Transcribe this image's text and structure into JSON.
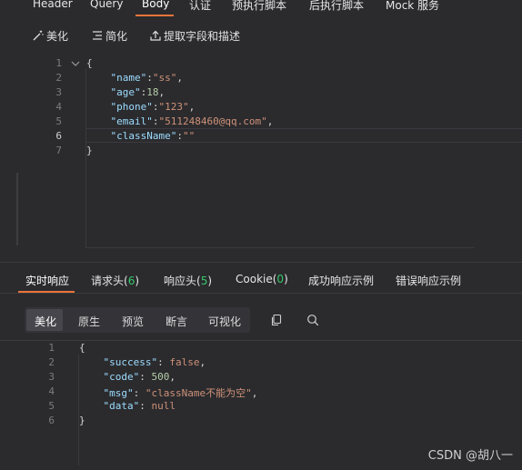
{
  "request_tabs": [
    "Header",
    "Query",
    "Body",
    "认证",
    "预执行脚本",
    "后执行脚本",
    "Mock 服务"
  ],
  "active_request_tab": "Body",
  "toolbar": {
    "beautify": "美化",
    "simplify": "简化",
    "extract": "提取字段和描述"
  },
  "request_body": {
    "line_numbers": [
      "1",
      "2",
      "3",
      "4",
      "5",
      "6",
      "7"
    ],
    "lines": [
      "{",
      "    \"name\":\"ss\",",
      "    \"age\":18,",
      "    \"phone\":\"123\",",
      "    \"email\":\"511248460@qq.com\",",
      "    \"className\":\"\"",
      "}"
    ],
    "active_line": "6"
  },
  "response_tabs": {
    "realtime": "实时响应",
    "req_headers": "请求头(",
    "req_headers_count": "6",
    "res_headers": "响应头(",
    "res_headers_count": "5",
    "cookie": "Cookie(",
    "cookie_count": "0",
    "close_paren": ")",
    "success_example": "成功响应示例",
    "error_example": "错误响应示例"
  },
  "response_views": [
    "美化",
    "原生",
    "预览",
    "断言",
    "可视化"
  ],
  "active_response_view": "美化",
  "response_body": {
    "line_numbers": [
      "1",
      "2",
      "3",
      "4",
      "5",
      "6"
    ],
    "lines": [
      "{",
      "    \"success\": false,",
      "    \"code\": 500,",
      "    \"msg\": \"className不能为空\",",
      "    \"data\": null",
      "}"
    ]
  },
  "watermark": "CSDN @胡八一",
  "colors": {
    "accent": "#e8743b",
    "count_green": "#35c76b",
    "background": "#2b2b2e"
  }
}
